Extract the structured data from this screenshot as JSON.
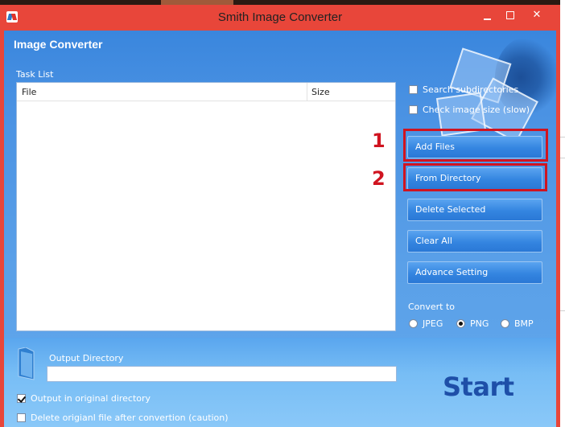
{
  "window": {
    "title": "Smith Image Converter",
    "min_icon": "minimize-icon",
    "max_icon": "maximize-icon",
    "close_glyph": "✕"
  },
  "header": {
    "title": "Image Converter"
  },
  "task_list": {
    "label": "Task List",
    "columns": [
      "File",
      "Size"
    ],
    "rows": []
  },
  "options": {
    "search_subdirectories": {
      "label": "Search subdirectories",
      "checked": false
    },
    "check_image_size": {
      "label": "Check image size (slow)",
      "checked": false
    }
  },
  "buttons": {
    "add_files": "Add Files",
    "from_directory": "From Directory",
    "delete_selected": "Delete Selected",
    "clear_all": "Clear All",
    "advance_setting": "Advance Setting"
  },
  "annotations": {
    "one": "1",
    "two": "2",
    "color": "#d01420"
  },
  "convert_to": {
    "label": "Convert to",
    "options": [
      "JPEG",
      "PNG",
      "BMP"
    ],
    "selected": "PNG"
  },
  "output": {
    "label": "Output Directory",
    "value": "",
    "output_in_original": {
      "label": "Output in original directory",
      "checked": true
    },
    "delete_original": {
      "label": "Delete origianl file after convertion (caution)",
      "checked": false
    }
  },
  "start_label": "Start",
  "colors": {
    "titlebar": "#e8463a",
    "panel": "#4a92e3",
    "button": "#3485e0",
    "start_text": "#1e4fa8"
  }
}
